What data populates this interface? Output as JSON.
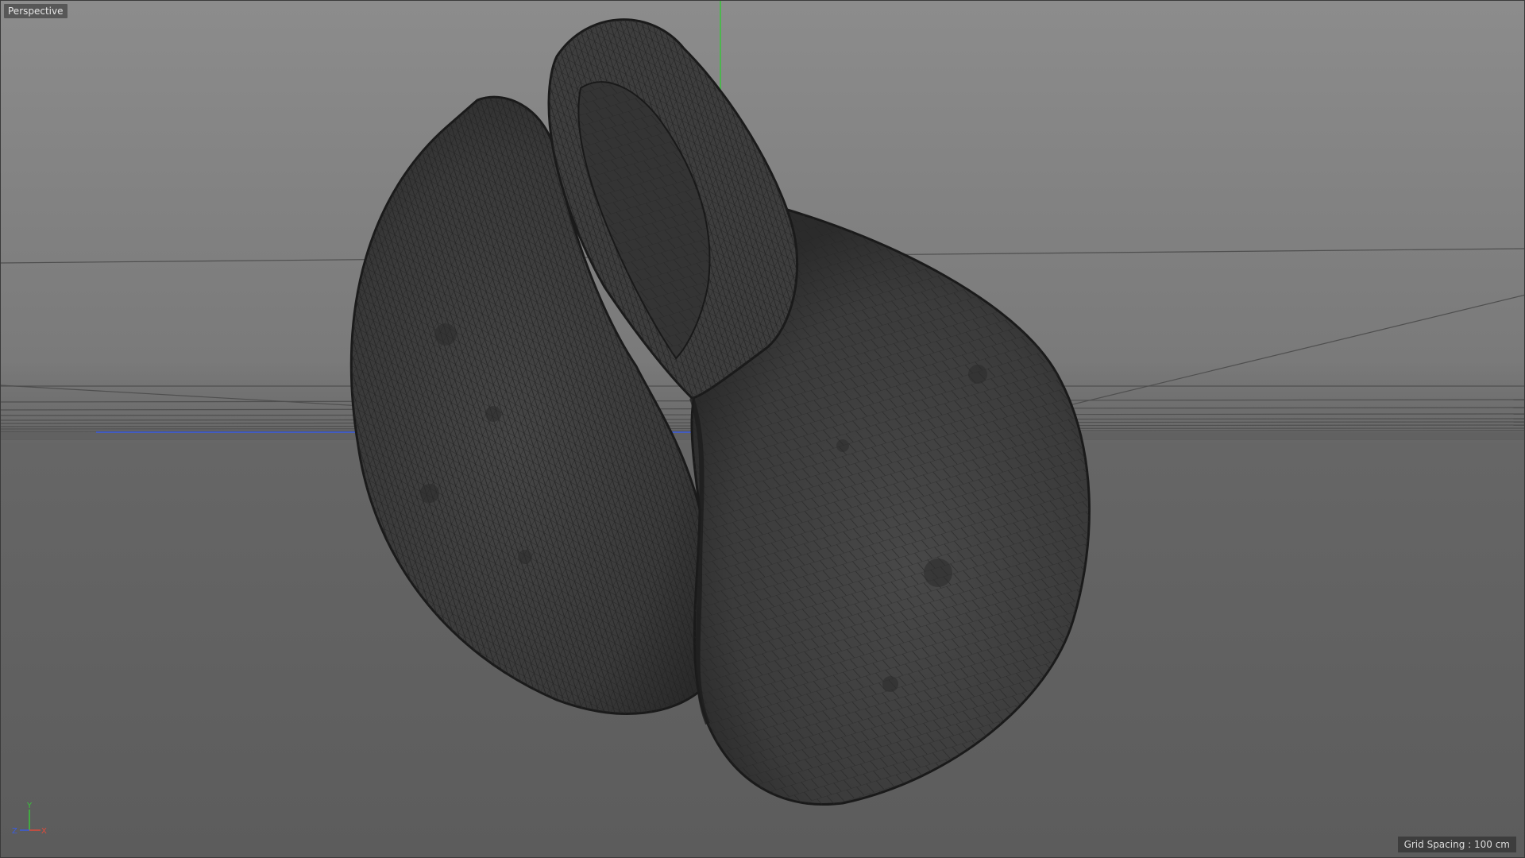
{
  "viewport": {
    "camera_label": "Perspective",
    "grid_spacing_label": "Grid Spacing : 100 cm",
    "render_mode": "wireframe"
  },
  "axes": {
    "x_label": "X",
    "y_label": "Y",
    "z_label": "Z",
    "x_color": "#e04a3a",
    "y_color": "#39c43a",
    "z_color": "#3a5ce0"
  },
  "colors": {
    "background_top": "#8c8c8c",
    "background_bottom": "#5c5c5c",
    "mesh_fill": "#3c3c3c",
    "mesh_wire": "#1e1e1e",
    "grid_line": "#4a4a4a"
  },
  "icons": [
    "axis-gizmo-icon"
  ]
}
